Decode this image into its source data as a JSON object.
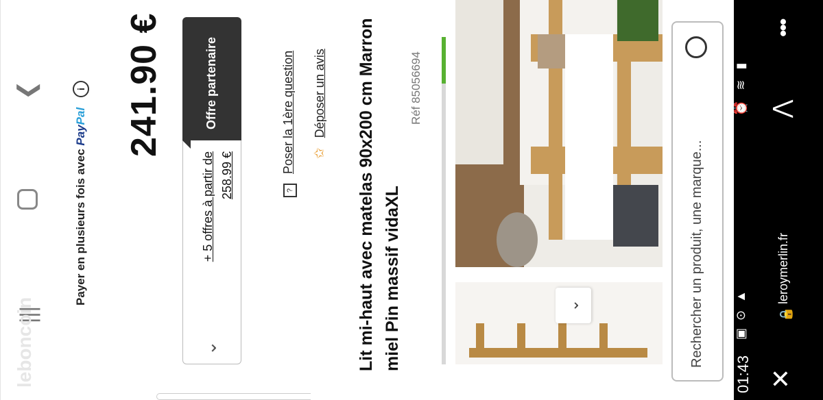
{
  "status_bar": {
    "time": "01:43",
    "left_icons": "▣ ⊙ ▲",
    "right_icons": "⏰ ≋ ▮"
  },
  "browser": {
    "domain": "leroymerlin.fr",
    "close_icon": "close-icon",
    "share_icon": "share-icon",
    "menu_icon": "more-icon"
  },
  "search": {
    "placeholder": "Rechercher un produit, une marque..."
  },
  "product": {
    "ref": "Réf 85056694",
    "title": "Lit mi-haut avec matelas 90x200 cm Marron miel Pin massif vidaXL",
    "review_link": "Déposer un avis",
    "question_link": "Poser la 1ère question"
  },
  "offers": {
    "tag": "Offre partenaire",
    "link": "+ 5 offres à partir de 258.99 €"
  },
  "price": {
    "value": "241.90 €",
    "installments": "Payer en plusieurs fois avec",
    "paypal_1": "Pay",
    "paypal_2": "Pal"
  },
  "watermark": "leboncoin",
  "colors": {
    "accent_green": "#58b131",
    "tag_bg": "#333333",
    "star": "#e89b2d"
  }
}
